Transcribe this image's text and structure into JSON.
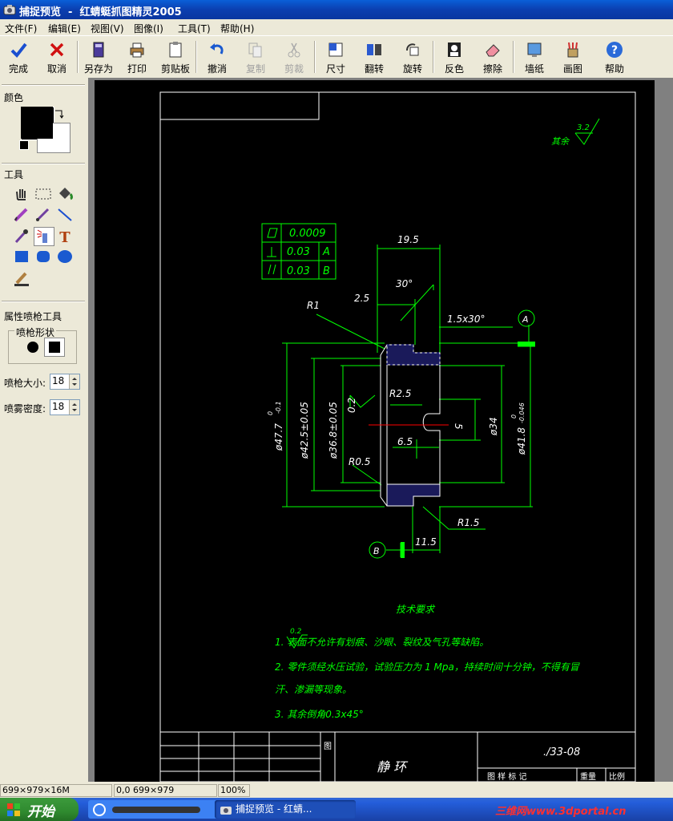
{
  "window": {
    "title": "捕捉预览  -  红蜻蜓抓图精灵2005"
  },
  "menu": [
    "文件(F)",
    "编辑(E)",
    "视图(V)",
    "图像(I)",
    "工具(T)",
    "帮助(H)"
  ],
  "toolbar": {
    "done": "完成",
    "cancel": "取消",
    "save_as": "另存为",
    "print": "打印",
    "clipboard": "剪贴板",
    "undo": "撤消",
    "copy": "复制",
    "cut": "剪裁",
    "size": "尺寸",
    "flip": "翻转",
    "rotate": "旋转",
    "invert": "反色",
    "erase": "擦除",
    "wallpaper": "墙纸",
    "paint": "画图",
    "help": "帮助"
  },
  "left_panel": {
    "color_label": "颜色",
    "tools_label": "工具",
    "props_label": "属性喷枪工具",
    "shape_label": "喷枪形状",
    "size_label": "喷枪大小:",
    "size_value": "18",
    "density_label": "喷雾密度:",
    "density_value": "18"
  },
  "drawing": {
    "roughness_rest": "其余",
    "roughness_rest_value": "3.2",
    "flatness": "0.0009",
    "perp": "0.03",
    "perp_ref": "A",
    "parallel": "0.03",
    "parallel_ref": "B",
    "dim_19_5": "19.5",
    "dim_30deg": "30°",
    "dim_2_5": "2.5",
    "dim_r1": "R1",
    "dim_chamfer": "1.5x30°",
    "datum_a": "A",
    "dim_r2_5": "R2.5",
    "roughness_bore": "0.2",
    "dim_5": "5",
    "dim_6_5": "6.5",
    "dim_r0_5": "R0.5",
    "dim_r1_5": "R1.5",
    "dim_11_5": "11.5",
    "datum_b": "B",
    "dim_d47": "ø47.7",
    "dim_d47_tol_up": "0",
    "dim_d47_tol_lo": "-0.1",
    "dim_d42": "ø42.5±0.05",
    "dim_d36": "ø36.8±0.05",
    "dim_d34": "ø34",
    "dim_d41": "ø41.8",
    "dim_d41_tol_up": "0",
    "dim_d41_tol_lo": "-0.046",
    "tech_title": "技术要求",
    "tech_1_rough": "0.2",
    "tech_1": "1.    表面不允许有划痕、沙眼、裂纹及气孔等缺陷。",
    "tech_2a": "2. 零件须经水压试验，试验压力为  1  Mpa，持续时间十分钟，不得有冒",
    "tech_2b": "汗、渗漏等现象。",
    "tech_3": "3. 其余倒角0.3x45°",
    "part_name": "静  环",
    "drawing_no": "./33-08",
    "title_block_labels": "图 样 标 记",
    "weight_label": "重量",
    "scale_label": "比例",
    "tu_label": "图"
  },
  "status": {
    "image_info": "699×979×16M",
    "coords": "0,0 699×979",
    "zoom": "100%"
  },
  "taskbar": {
    "start": "开始",
    "task1": "捕捉预览 - 红蜻...",
    "watermark": "三维网www.3dportal.cn"
  },
  "colors": {
    "line": "#00ff00",
    "text": "#00ff00",
    "white": "#ffffff",
    "hatch": "#3a3aa8",
    "accent_red": "#ff0000"
  }
}
